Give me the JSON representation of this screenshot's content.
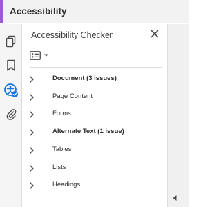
{
  "header": {
    "title": "Accessibility",
    "accent_color": "#9b5ad2"
  },
  "rail": {
    "items": [
      {
        "name": "pages-icon",
        "active": false
      },
      {
        "name": "bookmark-icon",
        "active": false
      },
      {
        "name": "accessibility-icon",
        "active": true
      },
      {
        "name": "attachment-icon",
        "active": false
      }
    ],
    "active_color": "#1473e6"
  },
  "panel": {
    "title": "Accessibility Checker",
    "close_icon": "close-icon",
    "options_icon": "options-list-icon"
  },
  "tree": [
    {
      "label": "Document (3 issues)",
      "bold": true,
      "underline": false
    },
    {
      "label": "Page Content",
      "bold": false,
      "underline": true
    },
    {
      "label": "Forms",
      "bold": false,
      "underline": false
    },
    {
      "label": "Alternate Text (1 issue)",
      "bold": true,
      "underline": false
    },
    {
      "label": "Tables",
      "bold": false,
      "underline": false
    },
    {
      "label": "Lists",
      "bold": false,
      "underline": false
    },
    {
      "label": "Headings",
      "bold": false,
      "underline": false
    }
  ],
  "collapse_icon": "caret-left-icon"
}
